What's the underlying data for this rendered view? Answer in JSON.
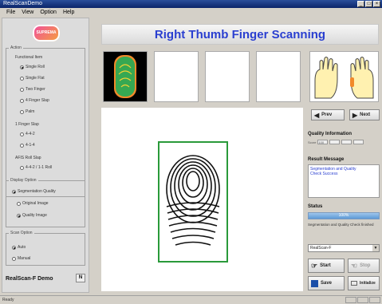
{
  "window": {
    "title": "RealScanDemo",
    "min_label": "_",
    "max_label": "□",
    "close_label": "×"
  },
  "menu": [
    "File",
    "View",
    "Option",
    "Help"
  ],
  "left": {
    "logo_text": "SUPREMA",
    "action_legend": "Action",
    "functional_label": "Functional Item",
    "action_items": [
      {
        "label": "Single Roll",
        "checked": true
      },
      {
        "label": "Single Flat",
        "checked": false
      },
      {
        "label": "Two Finger",
        "checked": false
      },
      {
        "label": "4 Finger Slap",
        "checked": false
      },
      {
        "label": "Palm",
        "checked": false
      }
    ],
    "finger_label": "1 Finger Slap",
    "finger_items": [
      {
        "label": "4-4-2",
        "checked": false
      },
      {
        "label": "4-1-4",
        "checked": false
      }
    ],
    "afis_label": "AFIS Roll Slap",
    "afis_items": [
      {
        "label": "4-4-2 / 1-1 Roll",
        "checked": false
      }
    ],
    "display_legend": "Display Option",
    "display_items": [
      {
        "label": "Segmentation Quality",
        "checked": true
      },
      {
        "label": "Original Image",
        "checked": false
      },
      {
        "label": "Quality Image",
        "checked": true
      }
    ],
    "scan_legend": "Scan Option",
    "scan_items": [
      {
        "label": "Auto",
        "checked": true
      },
      {
        "label": "Manual",
        "checked": false
      }
    ],
    "brand": "RealScan-F Demo",
    "brand_button": "N"
  },
  "header": {
    "title": "Right Thumb Finger Scanning"
  },
  "right": {
    "prev_label": "Prev",
    "next_label": "Next",
    "quality_title": "Quality Information",
    "quality_prefix": "Score",
    "quality_cells": [
      "100",
      "",
      "",
      ""
    ],
    "result_title": "Result Message",
    "result_lines": [
      "Segmentation and Quality",
      "Check Success"
    ],
    "status_title": "Status",
    "progress_text": "100%",
    "progress_fraction": 1.0,
    "status_message": "Segmentation and Quality Check finished",
    "device": "RealScan-F",
    "start_label": "Start",
    "stop_label": "Stop",
    "save_label": "Save",
    "initialize_label": "Initialize"
  },
  "statusbar": {
    "text": "Ready"
  },
  "colors": {
    "title": "#2a3fd0",
    "accent": "#2a9a3a",
    "hand_fill": "#fff1b0",
    "hand_highlight": "#f28a2a"
  }
}
